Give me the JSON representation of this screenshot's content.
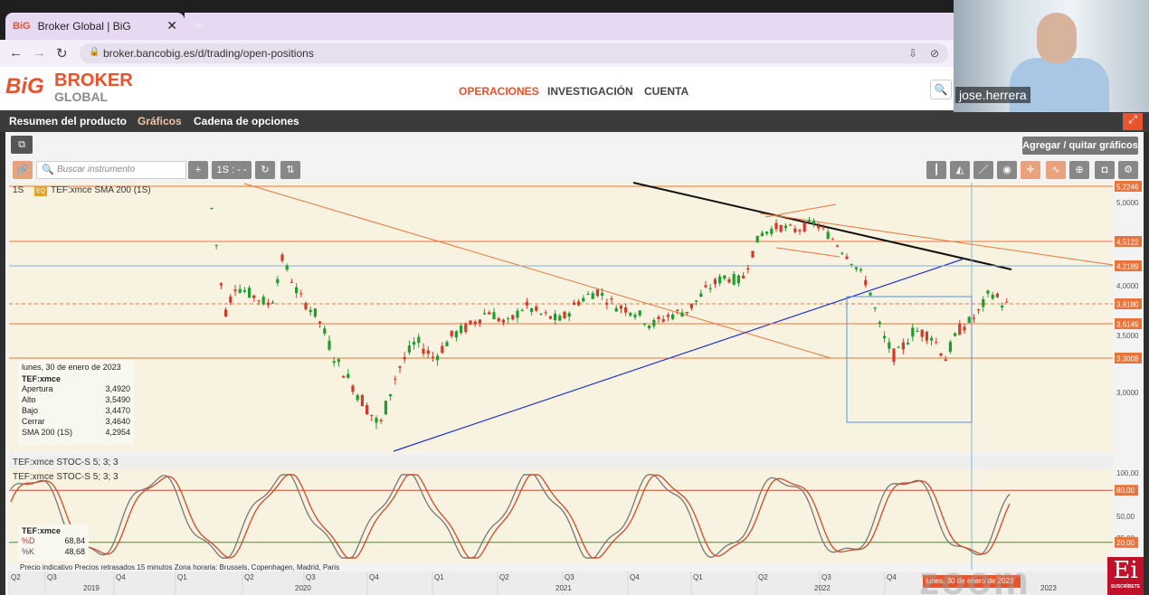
{
  "browser": {
    "tab_title": "Broker Global | BiG",
    "tab_favicon": "BiG",
    "url": "broker.bancobig.es/d/trading/open-positions"
  },
  "header": {
    "logo_big": "BiG",
    "logo_broker": "BROKER",
    "logo_global": "GLOBAL",
    "menu": [
      "OPERACIONES",
      "INVESTIGACIÓN",
      "CUENTA"
    ],
    "accent": "#e8532b"
  },
  "subnav": [
    "Resumen del producto",
    "Gráficos",
    "Cadena de opciones"
  ],
  "chart_panel": {
    "add_button": "Agregar / quitar gráficos",
    "search_placeholder": "Buscar instrumento",
    "add": "+",
    "interval": "1S : - -",
    "period_label": "1S",
    "instrument_badge": "EQ",
    "instrument_title": "TEF:xmce  SMA 200 (1S)"
  },
  "price_axis": {
    "levels": [
      "5,2246",
      "5,0000",
      "4,5122",
      "4,2189",
      "4,0000",
      "3,8180",
      "3,6149",
      "3,5000",
      "3,3008",
      "3,0000"
    ],
    "highlighted": [
      "5,2246",
      "4,5122",
      "4,2189",
      "3,8180",
      "3,6149",
      "3,3008"
    ]
  },
  "info": {
    "date": "lunes, 30 de enero de 2023",
    "symbol": "TEF:xmce",
    "rows": [
      {
        "k": "Apertura",
        "v": "3,4920"
      },
      {
        "k": "Alto",
        "v": "3,5490"
      },
      {
        "k": "Bajo",
        "v": "3,4470"
      },
      {
        "k": "Cerrar",
        "v": "3,4640"
      },
      {
        "k": "SMA 200 (1S)",
        "v": "4,2954"
      }
    ]
  },
  "stoch": {
    "title1": "TEF:xmce  STOC-S 5; 3; 3",
    "title2": "TEF:xmce  STOC-S 5; 3; 3",
    "axis": [
      "100,00",
      "80,00",
      "50,00",
      "25,00",
      "20,00"
    ],
    "symbol": "TEF:xmce",
    "d_label": "%D",
    "d_value": "68,84",
    "k_label": "%K",
    "k_value": "48,68"
  },
  "footer": "Precio indicativo  Precios retrasados 15 minutos  Zona horaria: Brussels, Copenhagen, Madrid, Paris",
  "quarters": [
    "Q2",
    "Q3",
    "Q4",
    "Q1",
    "Q2",
    "Q3",
    "Q4",
    "Q1",
    "Q2",
    "Q3",
    "Q4",
    "Q1",
    "Q2",
    "Q3",
    "Q4"
  ],
  "years": [
    "2019",
    "2020",
    "2021",
    "2022",
    "2023"
  ],
  "crosshair_date": "lunes, 30 de enero de 2023",
  "webcam": {
    "name": "jose.herrera"
  },
  "overlay": {
    "zoom": "zoom",
    "badge": "Ei",
    "badge_sub": "SUSCRÍBETE"
  }
}
